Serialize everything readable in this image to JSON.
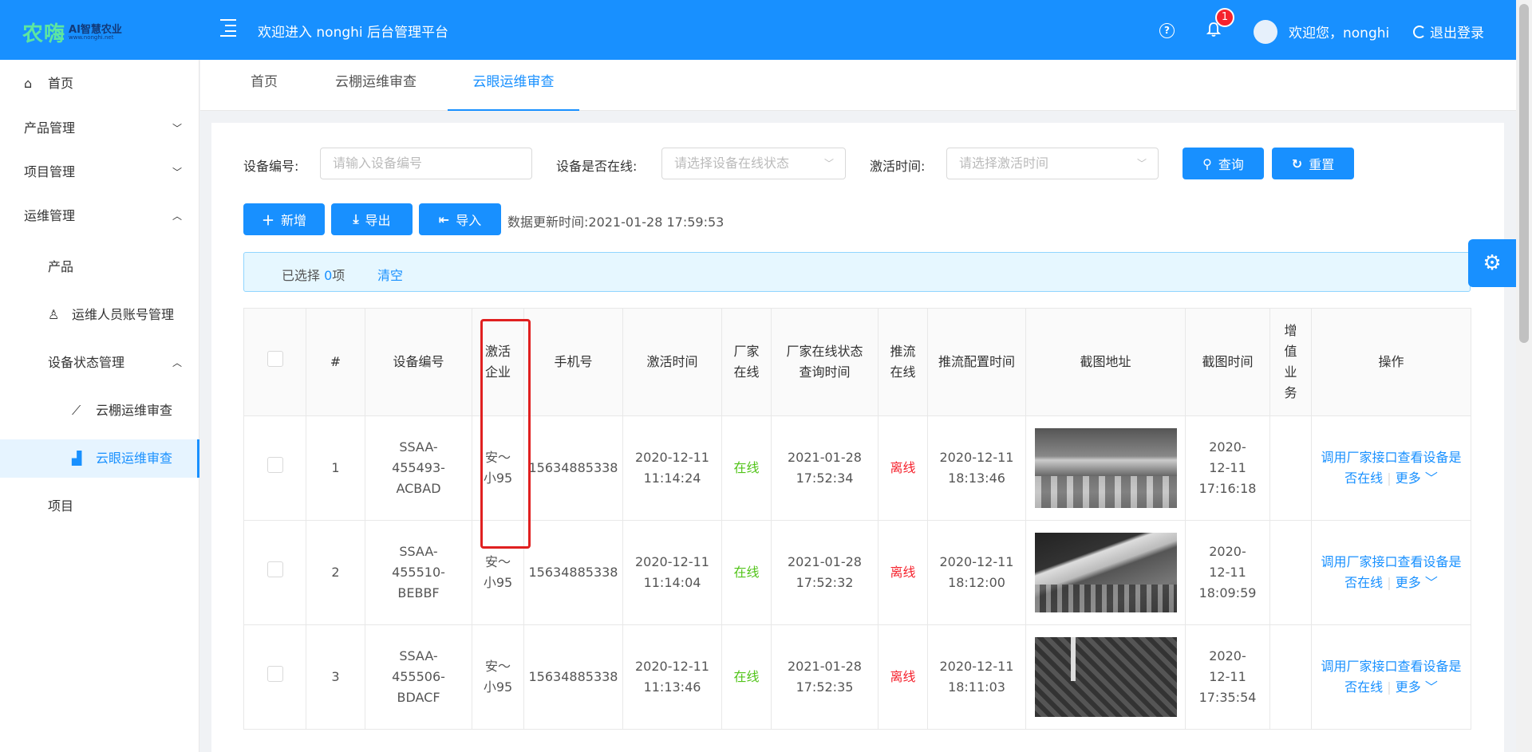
{
  "header": {
    "logo_mark": "农嗨",
    "logo_line1": "AI智慧农业",
    "logo_line2": "www.nonghi.net",
    "title": "欢迎进入 nonghi 后台管理平台",
    "notification_count": "1",
    "welcome": "欢迎您，nonghi",
    "logout_label": "退出登录"
  },
  "sidebar": {
    "items": [
      {
        "label": "首页"
      },
      {
        "label": "产品管理"
      },
      {
        "label": "项目管理"
      },
      {
        "label": "运维管理"
      },
      {
        "label": "产品"
      },
      {
        "label": "运维人员账号管理"
      },
      {
        "label": "设备状态管理"
      },
      {
        "label": "云棚运维审查"
      },
      {
        "label": "云眼运维审查"
      },
      {
        "label": "项目"
      }
    ]
  },
  "tabs": [
    {
      "label": "首页"
    },
    {
      "label": "云棚运维审查"
    },
    {
      "label": "云眼运维审查"
    }
  ],
  "filters": {
    "device_no_label": "设备编号:",
    "device_no_placeholder": "请输入设备编号",
    "online_label": "设备是否在线:",
    "online_placeholder": "请选择设备在线状态",
    "activate_label": "激活时间:",
    "activate_placeholder": "请选择激活时间",
    "query_label": "查询",
    "reset_label": "重置"
  },
  "toolbar": {
    "add_label": "新增",
    "export_label": "导出",
    "import_label": "导入",
    "update_time": "数据更新时间:2021-01-28 17:59:53"
  },
  "selection": {
    "prefix": "已选择",
    "count": "0",
    "suffix": "项",
    "clear_label": "清空"
  },
  "table": {
    "headers": [
      "#",
      "设备编号",
      "激活企业",
      "手机号",
      "激活时间",
      "厂家在线",
      "厂家在线状态查询时间",
      "推流在线",
      "推流配置时间",
      "截图地址",
      "截图时间",
      "增值业务",
      "操作"
    ],
    "rows": [
      {
        "idx": "1",
        "device_no": "SSAA-455493-ACBAD",
        "company": "安～小95",
        "phone": "15634885338",
        "activate_time": "2020-12-11 11:14:24",
        "vendor_online": "在线",
        "vendor_query_time": "2021-01-28 17:52:34",
        "stream_online": "离线",
        "stream_config_time": "2020-12-11 18:13:46",
        "shot_time": "2020-12-11 17:16:18",
        "action_link": "调用厂家接口查看设备是否在线",
        "more_label": "更多"
      },
      {
        "idx": "2",
        "device_no": "SSAA-455510-BEBBF",
        "company": "安～小95",
        "phone": "15634885338",
        "activate_time": "2020-12-11 11:14:04",
        "vendor_online": "在线",
        "vendor_query_time": "2021-01-28 17:52:32",
        "stream_online": "离线",
        "stream_config_time": "2020-12-11 18:12:00",
        "shot_time": "2020-12-11 18:09:59",
        "action_link": "调用厂家接口查看设备是否在线",
        "more_label": "更多"
      },
      {
        "idx": "3",
        "device_no": "SSAA-455506-BDACF",
        "company": "安～小95",
        "phone": "15634885338",
        "activate_time": "2020-12-11 11:13:46",
        "vendor_online": "在线",
        "vendor_query_time": "2021-01-28 17:52:35",
        "stream_online": "离线",
        "stream_config_time": "2020-12-11 18:11:03",
        "shot_time": "2020-12-11 17:35:54",
        "action_link": "调用厂家接口查看设备是否在线",
        "more_label": "更多"
      }
    ]
  },
  "colors": {
    "primary": "#1890ff",
    "online": "#52c41a",
    "offline": "#f5222d",
    "highlight": "#e02020"
  },
  "icons": [
    "home-icon",
    "menu-fold-icon",
    "help-icon",
    "bell-icon",
    "logout-icon",
    "user-icon",
    "line-chart-icon",
    "bar-chart-icon",
    "search-icon",
    "reload-icon",
    "plus-icon",
    "export-icon",
    "import-icon",
    "settings-icon"
  ]
}
